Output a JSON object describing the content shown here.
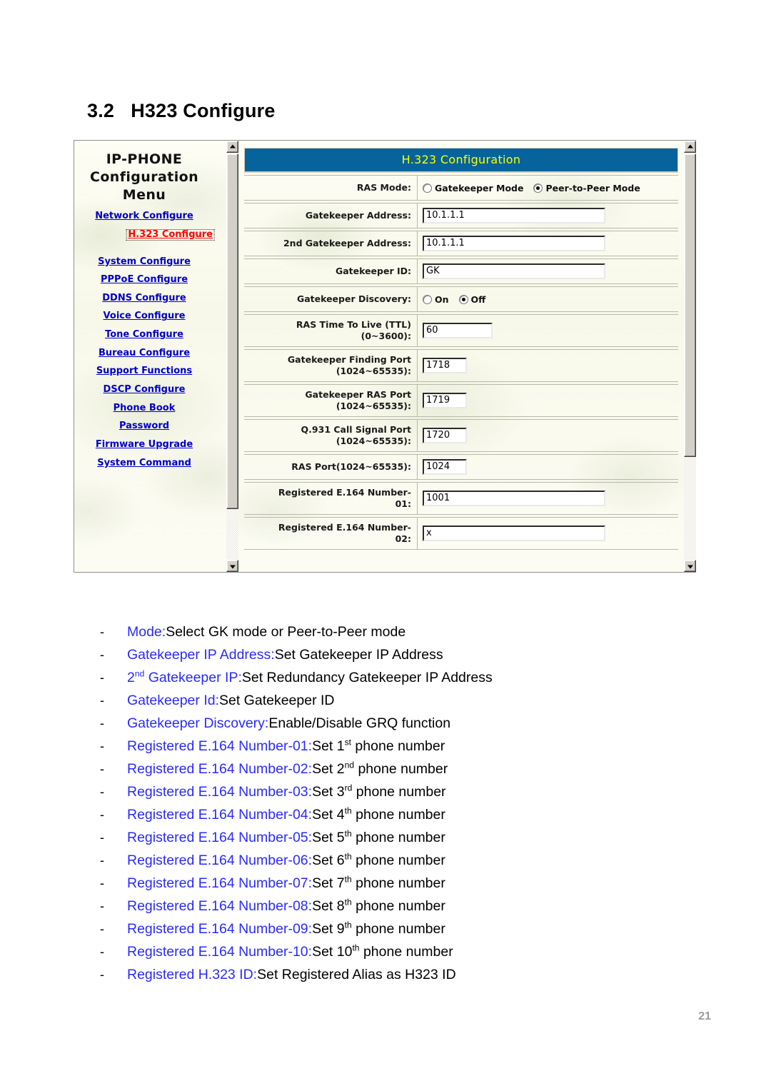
{
  "heading": "3.2   H323 Configure",
  "page_number": "21",
  "colors": {
    "titlebar_blue": "#06639b",
    "titlebar_text": "#ffff00",
    "link_blue": "#0000c8",
    "active_link_red": "#ff0000",
    "bullet_term_blue": "#2a2aff"
  },
  "menu": {
    "title_line1": "IP-PHONE",
    "title_line2": "Configuration",
    "title_line3": "Menu",
    "items": [
      {
        "label": "Network Configure",
        "active": false
      },
      {
        "label": "H.323 Configure",
        "active": true
      },
      {
        "label": "System Configure",
        "active": false
      },
      {
        "label": "PPPoE Configure",
        "active": false
      },
      {
        "label": "DDNS Configure",
        "active": false
      },
      {
        "label": "Voice Configure",
        "active": false
      },
      {
        "label": "Tone Configure",
        "active": false
      },
      {
        "label": "Bureau Configure",
        "active": false
      },
      {
        "label": "Support Functions",
        "active": false
      },
      {
        "label": "DSCP Configure",
        "active": false
      },
      {
        "label": "Phone Book",
        "active": false
      },
      {
        "label": "Password",
        "active": false
      },
      {
        "label": "Firmware Upgrade",
        "active": false
      },
      {
        "label": "System Command",
        "active": false
      }
    ]
  },
  "form": {
    "title": "H.323 Configuration",
    "rows": [
      {
        "label": "RAS Mode:",
        "type": "radio",
        "options": [
          {
            "label": "Gatekeeper Mode",
            "selected": false
          },
          {
            "label": "Peer-to-Peer Mode",
            "selected": true
          }
        ]
      },
      {
        "label": "Gatekeeper Address:",
        "type": "text",
        "value": "10.1.1.1",
        "size": "wide"
      },
      {
        "label": "2nd Gatekeeper Address:",
        "type": "text",
        "value": "10.1.1.1",
        "size": "wide"
      },
      {
        "label": "Gatekeeper ID:",
        "type": "text",
        "value": "GK",
        "size": "wide"
      },
      {
        "label": "Gatekeeper Discovery:",
        "type": "radio",
        "options": [
          {
            "label": "On",
            "selected": false
          },
          {
            "label": "Off",
            "selected": true
          }
        ]
      },
      {
        "label": "RAS Time To Live (TTL)\n(0~3600):",
        "type": "text",
        "value": "60",
        "size": "med"
      },
      {
        "label": "Gatekeeper Finding Port\n(1024~65535):",
        "type": "text",
        "value": "1718",
        "size": "small"
      },
      {
        "label": "Gatekeeper RAS Port\n(1024~65535):",
        "type": "text",
        "value": "1719",
        "size": "small"
      },
      {
        "label": "Q.931 Call Signal Port\n(1024~65535):",
        "type": "text",
        "value": "1720",
        "size": "small"
      },
      {
        "label": "RAS Port(1024~65535):",
        "type": "text",
        "value": "1024",
        "size": "small"
      },
      {
        "label": "Registered E.164 Number-\n01:",
        "type": "text",
        "value": "1001",
        "size": "wide"
      },
      {
        "label": "Registered E.164 Number-\n02:",
        "type": "text",
        "value": "x",
        "size": "wide"
      }
    ]
  },
  "bullets": [
    {
      "dash": "-",
      "term": "Mode:",
      "desc": " Select GK mode or Peer-to-Peer mode"
    },
    {
      "dash": "-",
      "term": "Gatekeeper IP Address:",
      "desc": " Set Gatekeeper IP Address"
    },
    {
      "dash": "-",
      "term": "2nd Gatekeeper IP:",
      "term_sup": "nd",
      "term_pre": "2",
      "term_post": " Gatekeeper IP:",
      "desc": " Set Redundancy Gatekeeper IP Address"
    },
    {
      "dash": "-",
      "term": "Gatekeeper Id:",
      "desc": " Set Gatekeeper ID"
    },
    {
      "dash": "-",
      "term": "Gatekeeper Discovery:",
      "desc": " Enable/Disable GRQ function"
    },
    {
      "dash": "-",
      "term": "Registered E.164 Number-01:",
      "desc": " Set 1st phone number",
      "desc_pre": " Set 1",
      "desc_sup": "st",
      "desc_post": " phone number"
    },
    {
      "dash": "-",
      "term": "Registered E.164 Number-02:",
      "desc": " Set 2nd phone number",
      "desc_pre": " Set 2",
      "desc_sup": "nd",
      "desc_post": " phone number"
    },
    {
      "dash": "-",
      "term": "Registered E.164 Number-03:",
      "desc": " Set 3rd phone number",
      "desc_pre": " Set 3",
      "desc_sup": "rd",
      "desc_post": " phone number"
    },
    {
      "dash": "-",
      "term": "Registered E.164 Number-04:",
      "desc": " Set 4th phone number",
      "desc_pre": " Set 4",
      "desc_sup": "th",
      "desc_post": " phone number"
    },
    {
      "dash": "-",
      "term": "Registered E.164 Number-05:",
      "desc": " Set 5th phone number",
      "desc_pre": " Set 5",
      "desc_sup": "th",
      "desc_post": " phone number"
    },
    {
      "dash": "-",
      "term": "Registered E.164 Number-06:",
      "desc": " Set 6th phone number",
      "desc_pre": " Set 6",
      "desc_sup": "th",
      "desc_post": " phone number"
    },
    {
      "dash": "-",
      "term": "Registered E.164 Number-07:",
      "desc": " Set 7th phone number",
      "desc_pre": " Set 7",
      "desc_sup": "th",
      "desc_post": " phone number"
    },
    {
      "dash": "-",
      "term": "Registered E.164 Number-08:",
      "desc": " Set 8th phone number",
      "desc_pre": " Set 8",
      "desc_sup": "th",
      "desc_post": " phone number"
    },
    {
      "dash": "-",
      "term": "Registered E.164 Number-09:",
      "desc": " Set 9th phone number",
      "desc_pre": " Set 9",
      "desc_sup": "th",
      "desc_post": " phone number"
    },
    {
      "dash": "-",
      "term": "Registered E.164 Number-10:",
      "desc": " Set 10th phone number",
      "desc_pre": " Set 10",
      "desc_sup": "th",
      "desc_post": " phone number"
    },
    {
      "dash": "-",
      "term": "Registered H.323 ID:",
      "desc": " Set Registered Alias as H323 ID"
    }
  ]
}
